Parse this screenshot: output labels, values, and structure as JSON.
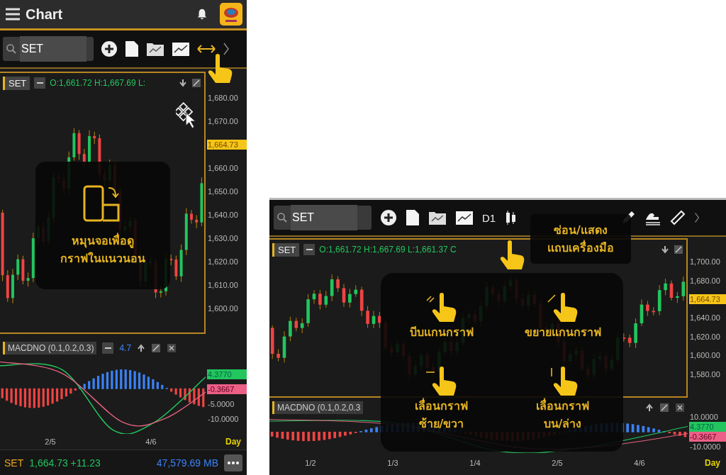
{
  "phone": {
    "title": "Chart",
    "search": {
      "value": "SET"
    },
    "chart": {
      "symbol": "SET",
      "ohlc": "O:1,661.72 H:1,667.69 L:",
      "price_labels": [
        {
          "text": "1,680.00",
          "kind": "plain"
        },
        {
          "text": "1,670.00",
          "kind": "plain"
        },
        {
          "text": "1,664.73",
          "kind": "current"
        },
        {
          "text": "1,660.00",
          "kind": "plain"
        },
        {
          "text": "1,650.00",
          "kind": "plain"
        },
        {
          "text": "1,640.00",
          "kind": "plain"
        },
        {
          "text": "1,630.00",
          "kind": "plain"
        },
        {
          "text": "1,620.00",
          "kind": "plain"
        },
        {
          "text": "1,610.00",
          "kind": "plain"
        },
        {
          "text": "1,600.00",
          "kind": "plain"
        }
      ]
    },
    "hint": {
      "lines": [
        "หมุนจอเพื่อดู",
        "กราฟในแนวนอน"
      ]
    },
    "macd": {
      "label": "MACDNO (0.1,0.2,0.3)",
      "value": "4.7",
      "axis_labels": [
        {
          "text": "4.3770",
          "kind": "up"
        },
        {
          "text": "-0.3667",
          "kind": "down"
        },
        {
          "text": "-5.0000",
          "kind": "plain"
        },
        {
          "text": "-10.0000",
          "kind": "plain"
        }
      ]
    },
    "x_labels": [
      "2/5",
      "4/6"
    ],
    "period": "Day",
    "status": {
      "symbol": "SET",
      "price": "1,664.73 +11.23",
      "volume": "47,579.69 MB"
    }
  },
  "tablet": {
    "search": {
      "value": "SET"
    },
    "timeframe": "D1",
    "tooltip": {
      "lines": [
        "ซ่อน/แสดง",
        "แถบเครื่องมือ"
      ]
    },
    "chart": {
      "symbol": "SET",
      "ohlc": "O:1,661.72 H:1,667.69 L:1,661.37 C",
      "price_labels": [
        {
          "text": "1,700.00",
          "kind": "plain"
        },
        {
          "text": "1,680.00",
          "kind": "plain"
        },
        {
          "text": "1,664.73",
          "kind": "current"
        },
        {
          "text": "1,640.00",
          "kind": "plain"
        },
        {
          "text": "1,620.00",
          "kind": "plain"
        },
        {
          "text": "1,600.00",
          "kind": "plain"
        },
        {
          "text": "1,580.00",
          "kind": "plain"
        }
      ]
    },
    "gestures": [
      {
        "kind": "pinch",
        "lines": [
          "บีบแกนกราฟ"
        ]
      },
      {
        "kind": "spread",
        "lines": [
          "ขยายแกนกราฟ"
        ]
      },
      {
        "kind": "horizontal",
        "lines": [
          "เลื่อนกราฟ",
          "ซ้าย/ขวา"
        ]
      },
      {
        "kind": "vertical",
        "lines": [
          "เลื่อนกราฟ",
          "บน/ล่าง"
        ]
      }
    ],
    "macd": {
      "label": "MACDNO (0.1,0.2,0.3",
      "axis_labels": [
        {
          "text": "10.0000",
          "kind": "plain"
        },
        {
          "text": "4.3770",
          "kind": "up"
        },
        {
          "text": "-0.3667",
          "kind": "down"
        },
        {
          "text": "-10.0000",
          "kind": "plain"
        }
      ]
    },
    "x_labels": [
      "1/2",
      "1/3",
      "1/4",
      "2/5",
      "4/6"
    ],
    "period": "Day"
  }
}
